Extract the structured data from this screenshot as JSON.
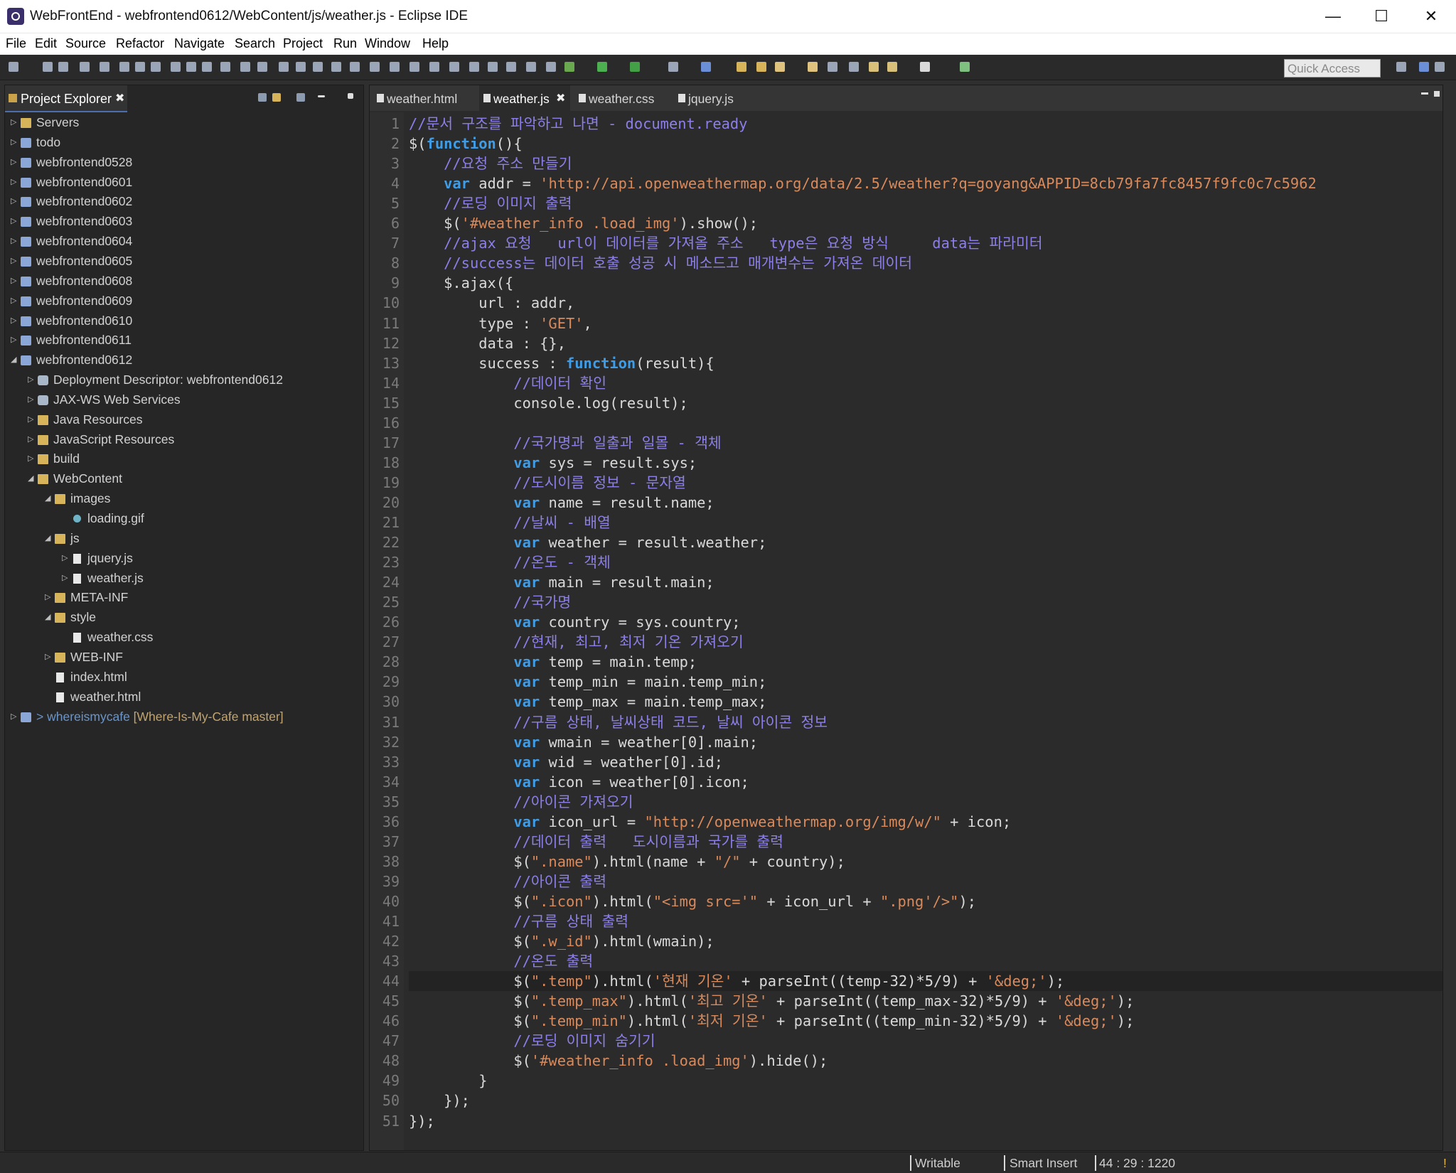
{
  "window": {
    "title": "WebFrontEnd - webfrontend0612/WebContent/js/weather.js - Eclipse IDE",
    "minimize": "—",
    "maximize": "☐",
    "close": "✕"
  },
  "menu": [
    "File",
    "Edit",
    "Source",
    "Refactor",
    "Navigate",
    "Search",
    "Project",
    "Run",
    "Window",
    "Help"
  ],
  "toolbar": {
    "quick_access_placeholder": "Quick Access"
  },
  "explorer": {
    "title": "Project Explorer",
    "close": "✖",
    "items": [
      {
        "label": "Servers",
        "icon": "folder-icon",
        "state": "collapsed"
      },
      {
        "label": "todo",
        "icon": "project-icon",
        "state": "collapsed"
      },
      {
        "label": "webfrontend0528",
        "icon": "project-icon",
        "state": "collapsed"
      },
      {
        "label": "webfrontend0601",
        "icon": "project-icon",
        "state": "collapsed"
      },
      {
        "label": "webfrontend0602",
        "icon": "project-icon",
        "state": "collapsed"
      },
      {
        "label": "webfrontend0603",
        "icon": "project-icon",
        "state": "collapsed"
      },
      {
        "label": "webfrontend0604",
        "icon": "project-icon",
        "state": "collapsed"
      },
      {
        "label": "webfrontend0605",
        "icon": "project-icon",
        "state": "collapsed"
      },
      {
        "label": "webfrontend0608",
        "icon": "project-icon",
        "state": "collapsed"
      },
      {
        "label": "webfrontend0609",
        "icon": "project-icon",
        "state": "collapsed"
      },
      {
        "label": "webfrontend0610",
        "icon": "project-icon",
        "state": "collapsed"
      },
      {
        "label": "webfrontend0611",
        "icon": "project-icon",
        "state": "collapsed"
      },
      {
        "label": "webfrontend0612",
        "icon": "project-icon",
        "state": "expanded"
      },
      {
        "label": "Deployment Descriptor: webfrontend0612",
        "icon": "descriptor-icon",
        "state": "collapsed"
      },
      {
        "label": "JAX-WS Web Services",
        "icon": "webservice-icon",
        "state": "collapsed"
      },
      {
        "label": "Java Resources",
        "icon": "folder-icon",
        "state": "collapsed"
      },
      {
        "label": "JavaScript Resources",
        "icon": "folder-icon",
        "state": "collapsed"
      },
      {
        "label": "build",
        "icon": "folder-icon",
        "state": "collapsed"
      },
      {
        "label": "WebContent",
        "icon": "folder-icon",
        "state": "expanded"
      },
      {
        "label": "images",
        "icon": "folder-icon",
        "state": "expanded"
      },
      {
        "label": "loading.gif",
        "icon": "gif-icon",
        "state": "leaf"
      },
      {
        "label": "js",
        "icon": "folder-icon",
        "state": "expanded"
      },
      {
        "label": "jquery.js",
        "icon": "js-file-icon",
        "state": "collapsed"
      },
      {
        "label": "weather.js",
        "icon": "js-file-icon",
        "state": "collapsed"
      },
      {
        "label": "META-INF",
        "icon": "folder-icon",
        "state": "collapsed"
      },
      {
        "label": "style",
        "icon": "folder-icon",
        "state": "expanded"
      },
      {
        "label": "weather.css",
        "icon": "css-file-icon",
        "state": "leaf"
      },
      {
        "label": "WEB-INF",
        "icon": "folder-icon",
        "state": "collapsed"
      },
      {
        "label": "index.html",
        "icon": "html-file-icon",
        "state": "leaf"
      },
      {
        "label": "weather.html",
        "icon": "html-file-icon",
        "state": "leaf"
      }
    ],
    "git_item": {
      "prefix": "> ",
      "label": "whereismycafe",
      "branch": " [Where-Is-My-Cafe master]"
    }
  },
  "editor": {
    "tabs": [
      {
        "label": "weather.html",
        "active": false
      },
      {
        "label": "weather.js",
        "active": true
      },
      {
        "label": "weather.css",
        "active": false
      },
      {
        "label": "jquery.js",
        "active": false
      }
    ],
    "tab_close": "✖",
    "current_line": 44,
    "lines": [
      "//문서 구조를 파악하고 나면 - document.ready",
      "$(function(){",
      "    //요청 주소 만들기",
      "    var addr = 'http://api.openweathermap.org/data/2.5/weather?q=goyang&APPID=8cb79fa7fc8457f9fc0c7c5962",
      "    //로딩 이미지 출력",
      "    $('#weather_info .load_img').show();",
      "    //ajax 요청   url이 데이터를 가져올 주소   type은 요청 방식     data는 파라미터",
      "    //success는 데이터 호출 성공 시 메소드고 매개변수는 가져온 데이터",
      "    $.ajax({",
      "        url : addr,",
      "        type : 'GET',",
      "        data : {},",
      "        success : function(result){",
      "            //데이터 확인",
      "            console.log(result);",
      "",
      "            //국가명과 일출과 일몰 - 객체",
      "            var sys = result.sys;",
      "            //도시이름 정보 - 문자열",
      "            var name = result.name;",
      "            //날씨 - 배열",
      "            var weather = result.weather;",
      "            //온도 - 객체",
      "            var main = result.main;",
      "            //국가명",
      "            var country = sys.country;",
      "            //현재, 최고, 최저 기온 가져오기",
      "            var temp = main.temp;",
      "            var temp_min = main.temp_min;",
      "            var temp_max = main.temp_max;",
      "            //구름 상태, 날씨상태 코드, 날씨 아이콘 정보",
      "            var wmain = weather[0].main;",
      "            var wid = weather[0].id;",
      "            var icon = weather[0].icon;",
      "            //아이콘 가져오기",
      "            var icon_url = \"http://openweathermap.org/img/w/\" + icon;",
      "            //데이터 출력   도시이름과 국가를 출력",
      "            $(\".name\").html(name + \"/\" + country);",
      "            //아이콘 출력",
      "            $(\".icon\").html(\"<img src='\" + icon_url + \".png'/>\");",
      "            //구름 상태 출력",
      "            $(\".w_id\").html(wmain);",
      "            //온도 출력",
      "            $(\".temp\").html('현재 기온' + parseInt((temp-32)*5/9) + '&deg;');",
      "            $(\".temp_max\").html('최고 기온' + parseInt((temp_max-32)*5/9) + '&deg;');",
      "            $(\".temp_min\").html('최저 기온' + parseInt((temp_min-32)*5/9) + '&deg;');",
      "            //로딩 이미지 숨기기",
      "            $('#weather_info .load_img').hide();",
      "        }",
      "    });",
      "});"
    ]
  },
  "status": {
    "mode": "Writable",
    "insert": "Smart Insert",
    "position": "44 : 29 : 1220"
  },
  "colors": {
    "comment": "#8c7fe8",
    "keyword": "#3f9de8",
    "string": "#d98a5c",
    "function": "#e0c27f",
    "background": "#2b2b2b"
  }
}
